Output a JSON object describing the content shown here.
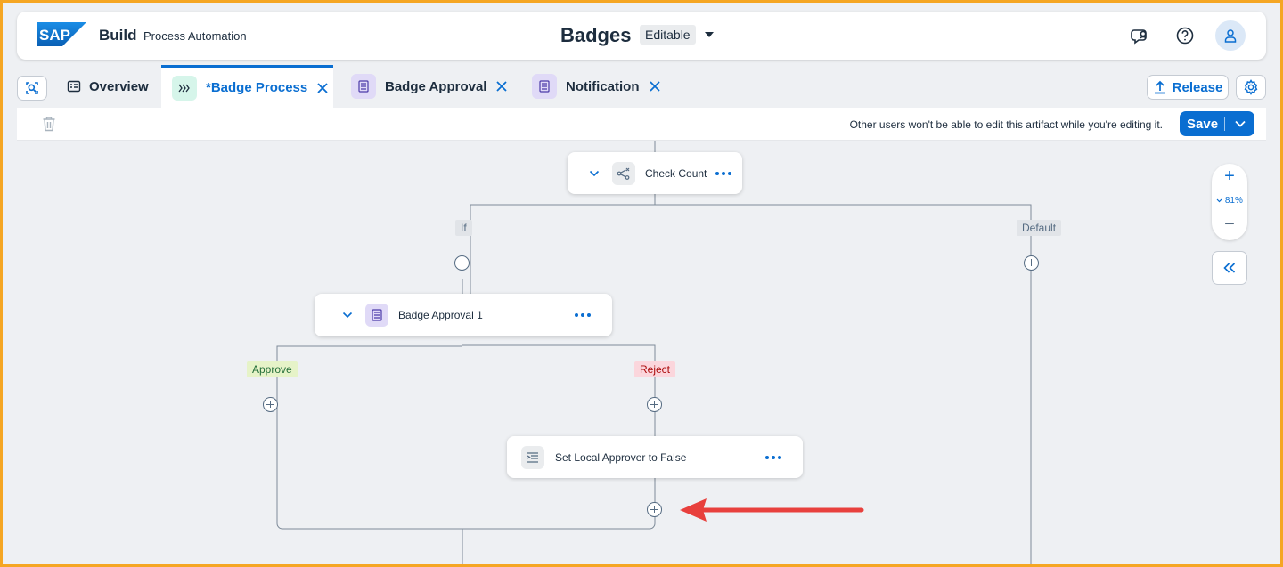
{
  "shell": {
    "logo_text": "SAP",
    "brand": "Build",
    "product": "Process Automation",
    "title": "Badges",
    "status": "Editable"
  },
  "tabs": [
    {
      "label": "Overview"
    },
    {
      "label": "*Badge Process"
    },
    {
      "label": "Badge Approval"
    },
    {
      "label": "Notification"
    }
  ],
  "actions": {
    "release": "Release",
    "save": "Save"
  },
  "toolbar": {
    "lock_message": "Other users won't be able to edit this artifact while you're editing it."
  },
  "flow": {
    "check_count": "Check Count",
    "branch_if": "If",
    "branch_default": "Default",
    "badge_approval": "Badge Approval 1",
    "approve": "Approve",
    "reject": "Reject",
    "set_local": "Set Local Approver to False"
  },
  "zoom": {
    "level": "81%"
  },
  "colors": {
    "accent": "#0a6ed1",
    "frame": "#f5a623",
    "approve": "#e6f3c8",
    "reject": "#fbd6dc",
    "arrow": "#e8403d"
  },
  "icons": [
    "sap-logo",
    "feedback-icon",
    "help-icon",
    "user-icon",
    "search-canvas-icon",
    "overview-icon",
    "process-icon",
    "form-icon",
    "close-icon",
    "upload-icon",
    "gear-icon",
    "trash-icon",
    "chevron-down-icon",
    "condition-icon",
    "more-icon",
    "script-icon",
    "add-icon",
    "collapse-panel-icon",
    "annotation-arrow"
  ]
}
